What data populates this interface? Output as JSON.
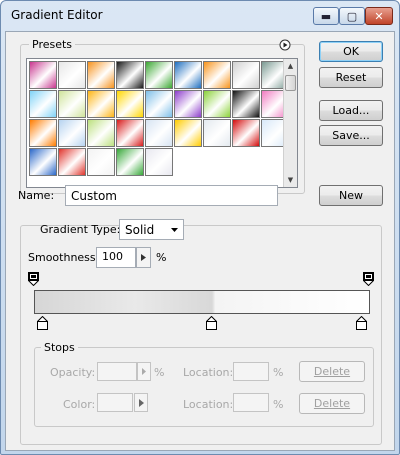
{
  "window": {
    "title": "Gradient Editor"
  },
  "titlebar_buttons": {
    "minimize": "▬",
    "maximize": "▢",
    "close": "✕"
  },
  "presets": {
    "label": "Presets",
    "menu_icon": "play-circle-icon",
    "swatches": [
      [
        "#c8378f",
        "#e7e7e7",
        "#f7931e",
        "#1a1a1a",
        "#3da834",
        "#2170c0",
        "#f7941d",
        "#d0d0d0",
        "",
        "#7a9a92",
        "#7fd3f7",
        "#cfe39a",
        "#fdb515",
        "#ffd700",
        "#7fbfe8",
        "#8d3ecb",
        "#8cd23a",
        "",
        "#111111",
        "#f07bc0",
        "#ff7c00",
        "#b6d3f0",
        "#bce07f",
        "#d81d1d",
        "#d7e4f3",
        "#ffcc00",
        "",
        "#e3e9ef",
        "#d40c0c",
        "#d8e8f8",
        "#2b68c9",
        "#e0342c",
        "#f3f3f3",
        "#38a83a",
        "#e8e8f0",
        ""
      ]
    ]
  },
  "buttons": {
    "ok": "OK",
    "reset": "Reset",
    "load": "Load...",
    "save": "Save...",
    "new": "New",
    "delete1": "Delete",
    "delete2": "Delete"
  },
  "name": {
    "label": "Name:",
    "value": "Custom"
  },
  "gradient_type": {
    "label": "Gradient Type:",
    "value": "Solid"
  },
  "smoothness": {
    "label": "Smoothness:",
    "value": "100",
    "unit": "%"
  },
  "stops": {
    "label": "Stops",
    "opacity_label": "Opacity:",
    "opacity_unit": "%",
    "color_label": "Color:",
    "location_label1": "Location:",
    "location_unit1": "%",
    "location_label2": "Location:",
    "location_unit2": "%"
  },
  "colors": {
    "accent": "#3c7fb1",
    "panel": "#f0f0f0"
  }
}
